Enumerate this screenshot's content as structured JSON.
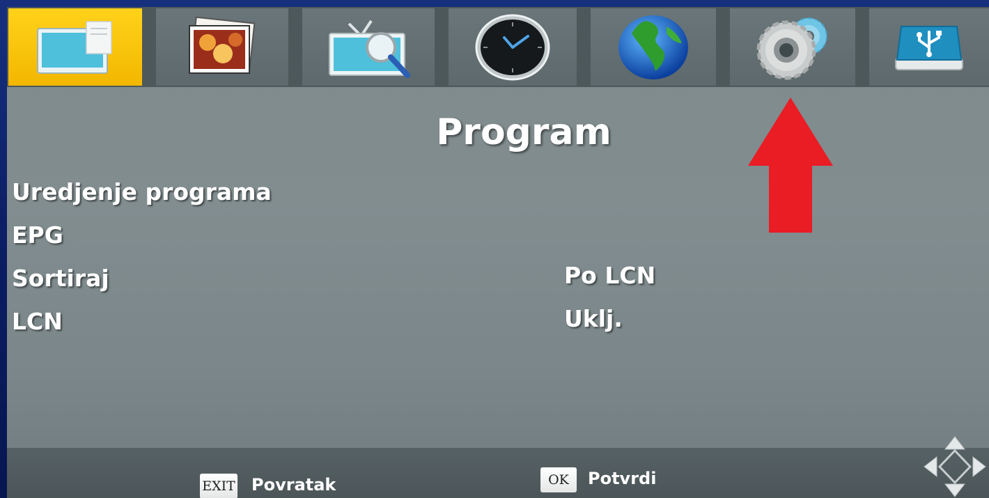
{
  "tabs": [
    {
      "name": "picture-tab",
      "icon": "picture-icon",
      "active": true
    },
    {
      "name": "photos-tab",
      "icon": "photos-icon",
      "active": false
    },
    {
      "name": "tv-search-tab",
      "icon": "tv-search-icon",
      "active": false
    },
    {
      "name": "clock-tab",
      "icon": "clock-icon",
      "active": false
    },
    {
      "name": "globe-tab",
      "icon": "globe-icon",
      "active": false
    },
    {
      "name": "settings-tab",
      "icon": "gears-icon",
      "active": false
    },
    {
      "name": "usb-tab",
      "icon": "usb-icon",
      "active": false
    }
  ],
  "page": {
    "title": "Program"
  },
  "menu": [
    {
      "label": "Uredjenje programa",
      "value": ""
    },
    {
      "label": "EPG",
      "value": ""
    },
    {
      "label": "Sortiraj",
      "value": "Po LCN"
    },
    {
      "label": "LCN",
      "value": "Uklj."
    }
  ],
  "footer": {
    "exit_key": "EXIT",
    "exit_label": "Povratak",
    "ok_key": "OK",
    "ok_label": "Potvrdi"
  },
  "colors": {
    "active_tab": "#f3b700",
    "screen_bg": "#7e8a8c",
    "annotation_arrow": "#ea1c24"
  }
}
